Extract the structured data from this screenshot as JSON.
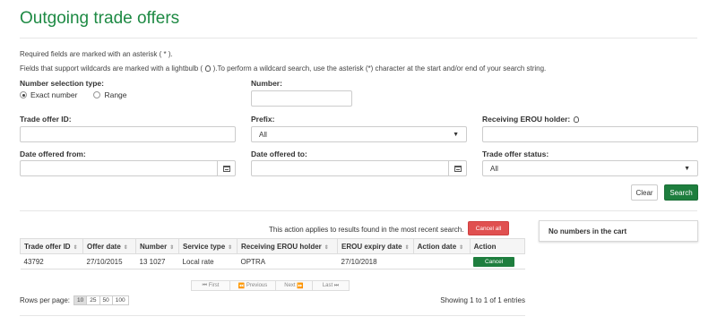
{
  "page": {
    "title": "Outgoing trade offers"
  },
  "notes": {
    "required": "Required fields are marked with an asterisk ( * ).",
    "wildcard_pre": "Fields that support wildcards are marked with a lightbulb (",
    "wildcard_post": ").To perform a wildcard search, use the asterisk (*) character at the start and/or end of your search string."
  },
  "form": {
    "number_selection_label": "Number selection type:",
    "radio_exact": "Exact number",
    "radio_range": "Range",
    "number_label": "Number:",
    "number_value": "",
    "trade_offer_id_label": "Trade offer ID:",
    "trade_offer_id_value": "",
    "prefix_label": "Prefix:",
    "prefix_value": "All",
    "receiving_holder_label": "Receiving EROU holder:",
    "receiving_holder_value": "",
    "date_from_label": "Date offered from:",
    "date_from_value": "",
    "date_to_label": "Date offered to:",
    "date_to_value": "",
    "status_label": "Trade offer status:",
    "status_value": "All",
    "clear_label": "Clear",
    "search_label": "Search"
  },
  "results": {
    "applies_text": "This action applies to results found in the most recent search.",
    "cancel_all_label": "Cancel all",
    "columns": [
      "Trade offer ID",
      "Offer date",
      "Number",
      "Service type",
      "Receiving EROU holder",
      "EROU expiry date",
      "Action date",
      "Action"
    ],
    "rows": [
      {
        "id": "43792",
        "offer_date": "27/10/2015",
        "number": "13 1027",
        "service": "Local rate",
        "holder": "OPTRA",
        "expiry": "27/10/2018",
        "action_date": "",
        "action": "Cancel"
      }
    ],
    "pager": {
      "first": "First",
      "previous": "Previous",
      "next": "Next",
      "last": "Last"
    },
    "rows_per_page_label": "Rows per page:",
    "rows_per_page_options": [
      "10",
      "25",
      "50",
      "100"
    ],
    "showing": "Showing 1 to 1 of 1 entries"
  },
  "cart": {
    "text": "No numbers in the cart"
  }
}
